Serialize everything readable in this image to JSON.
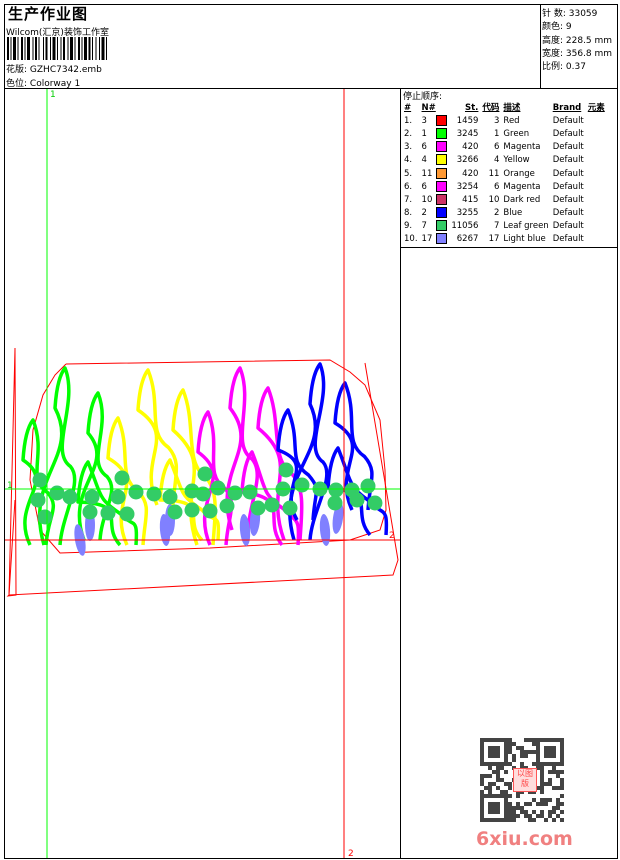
{
  "header": {
    "title": "生产作业图",
    "company": "Wilcom(汇京)装饰工作室",
    "design_label": "花版:",
    "design_value": "GZHC7342.emb",
    "colorway_label": "色位:",
    "colorway_value": "Colorway 1"
  },
  "info": {
    "stitches": "针 数: 33059",
    "colors": "颜色: 9",
    "height": "高度: 228.5 mm",
    "width": "宽度: 356.8 mm",
    "scale": "比例: 0.37"
  },
  "stop_sequence": {
    "title": "停止顺序:",
    "columns": [
      "#",
      "N#",
      "St.",
      "代码",
      "描述",
      "Brand",
      "元素"
    ],
    "rows": [
      {
        "idx": "1.",
        "n": "3",
        "color": "#ff0000",
        "st": "1459",
        "code": "3",
        "desc": "Red",
        "brand": "Default"
      },
      {
        "idx": "2.",
        "n": "1",
        "color": "#00ff00",
        "st": "3245",
        "code": "1",
        "desc": "Green",
        "brand": "Default"
      },
      {
        "idx": "3.",
        "n": "6",
        "color": "#ff00ff",
        "st": "420",
        "code": "6",
        "desc": "Magenta",
        "brand": "Default"
      },
      {
        "idx": "4.",
        "n": "4",
        "color": "#ffff00",
        "st": "3266",
        "code": "4",
        "desc": "Yellow",
        "brand": "Default"
      },
      {
        "idx": "5.",
        "n": "11",
        "color": "#ff9933",
        "st": "420",
        "code": "11",
        "desc": "Orange",
        "brand": "Default"
      },
      {
        "idx": "6.",
        "n": "6",
        "color": "#ff00ff",
        "st": "3254",
        "code": "6",
        "desc": "Magenta",
        "brand": "Default"
      },
      {
        "idx": "7.",
        "n": "10",
        "color": "#cc3366",
        "st": "415",
        "code": "10",
        "desc": "Dark red",
        "brand": "Default"
      },
      {
        "idx": "8.",
        "n": "2",
        "color": "#0000ff",
        "st": "3255",
        "code": "2",
        "desc": "Blue",
        "brand": "Default"
      },
      {
        "idx": "9.",
        "n": "7",
        "color": "#33cc66",
        "st": "11056",
        "code": "7",
        "desc": "Leaf green",
        "brand": "Default"
      },
      {
        "idx": "10.",
        "n": "17",
        "color": "#8080ff",
        "st": "6267",
        "code": "17",
        "desc": "Light blue",
        "brand": "Default"
      }
    ]
  },
  "guides": {
    "green_v": "1",
    "green_h": "1",
    "red_v": "2",
    "red_h": "2"
  },
  "watermark": {
    "text": "6xiu.com",
    "stamp": "以图版"
  }
}
